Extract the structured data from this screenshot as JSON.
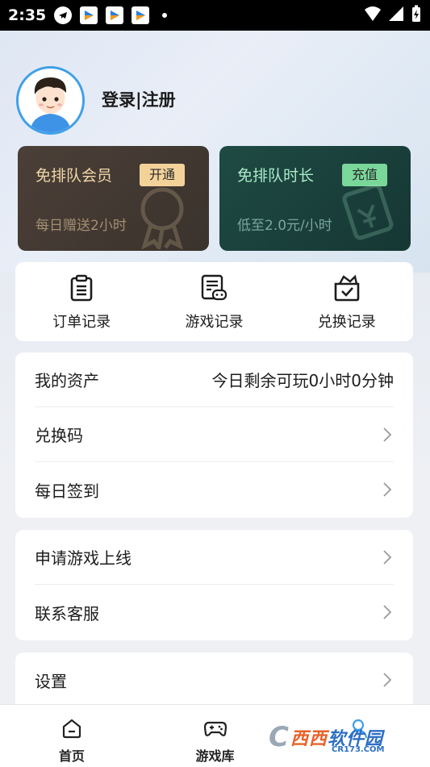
{
  "status_bar": {
    "time": "2:35"
  },
  "profile": {
    "login_label": "登录|注册"
  },
  "promos": {
    "vip": {
      "title": "免排队会员",
      "badge": "开通",
      "subtitle": "每日赠送2小时"
    },
    "time": {
      "title": "免排队时长",
      "badge": "充值",
      "subtitle": "低至2.0元/小时"
    }
  },
  "quick_actions": [
    {
      "label": "订单记录",
      "icon": "clipboard-icon"
    },
    {
      "label": "游戏记录",
      "icon": "game-record-icon"
    },
    {
      "label": "兑换记录",
      "icon": "gift-box-icon"
    }
  ],
  "assets": {
    "label": "我的资产",
    "value": "今日剩余可玩0小时0分钟",
    "rows": [
      {
        "label": "兑换码"
      },
      {
        "label": "每日签到"
      }
    ]
  },
  "more": {
    "rows": [
      {
        "label": "申请游戏上线"
      },
      {
        "label": "联系客服"
      }
    ]
  },
  "settings": {
    "label": "设置"
  },
  "bottom_nav": [
    {
      "label": "首页",
      "icon": "home-icon"
    },
    {
      "label": "游戏库",
      "icon": "gamepad-icon"
    }
  ],
  "watermark": {
    "main_a": "西西",
    "main_b": "软件园",
    "sub": "CR173.COM"
  }
}
